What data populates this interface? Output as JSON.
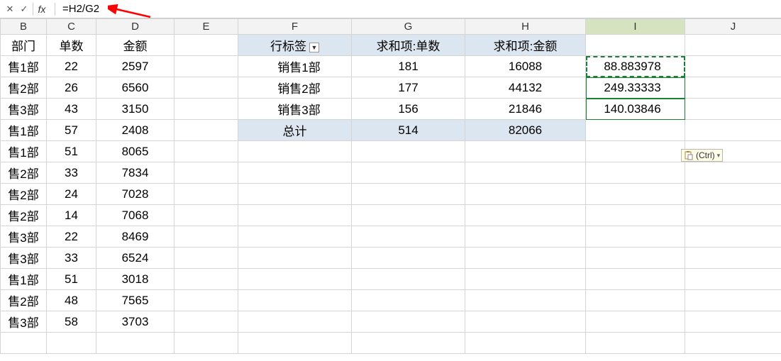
{
  "formula_bar": {
    "cancel": "✕",
    "check": "✓",
    "fx": "fx",
    "formula": "=H2/G2"
  },
  "columns": {
    "B": "B",
    "C": "C",
    "D": "D",
    "E": "E",
    "F": "F",
    "G": "G",
    "H": "H",
    "I": "I",
    "J": "J"
  },
  "left_table": {
    "headers": {
      "b": "部门",
      "c": "单数",
      "d": "金额"
    },
    "rows": [
      {
        "b": "售1部",
        "c": "22",
        "d": "2597"
      },
      {
        "b": "售2部",
        "c": "26",
        "d": "6560"
      },
      {
        "b": "售3部",
        "c": "43",
        "d": "3150"
      },
      {
        "b": "售1部",
        "c": "57",
        "d": "2408"
      },
      {
        "b": "售1部",
        "c": "51",
        "d": "8065"
      },
      {
        "b": "售2部",
        "c": "33",
        "d": "7834"
      },
      {
        "b": "售2部",
        "c": "24",
        "d": "7028"
      },
      {
        "b": "售2部",
        "c": "14",
        "d": "7068"
      },
      {
        "b": "售3部",
        "c": "22",
        "d": "8469"
      },
      {
        "b": "售3部",
        "c": "33",
        "d": "6524"
      },
      {
        "b": "售1部",
        "c": "51",
        "d": "3018"
      },
      {
        "b": "售2部",
        "c": "48",
        "d": "7565"
      },
      {
        "b": "售3部",
        "c": "58",
        "d": "3703"
      }
    ]
  },
  "pivot": {
    "header": {
      "f": "行标签",
      "g": "求和项:单数",
      "h": "求和项:金额"
    },
    "rows": [
      {
        "f": "销售1部",
        "g": "181",
        "h": "16088",
        "i": "88.883978"
      },
      {
        "f": "销售2部",
        "g": "177",
        "h": "44132",
        "i": "249.33333"
      },
      {
        "f": "销售3部",
        "g": "156",
        "h": "21846",
        "i": "140.03846"
      }
    ],
    "total": {
      "f": "总计",
      "g": "514",
      "h": "82066"
    }
  },
  "ctrl_popup": {
    "label": "(Ctrl)"
  },
  "dropdown_glyph": "▼",
  "ctrl_dd_glyph": "▾"
}
